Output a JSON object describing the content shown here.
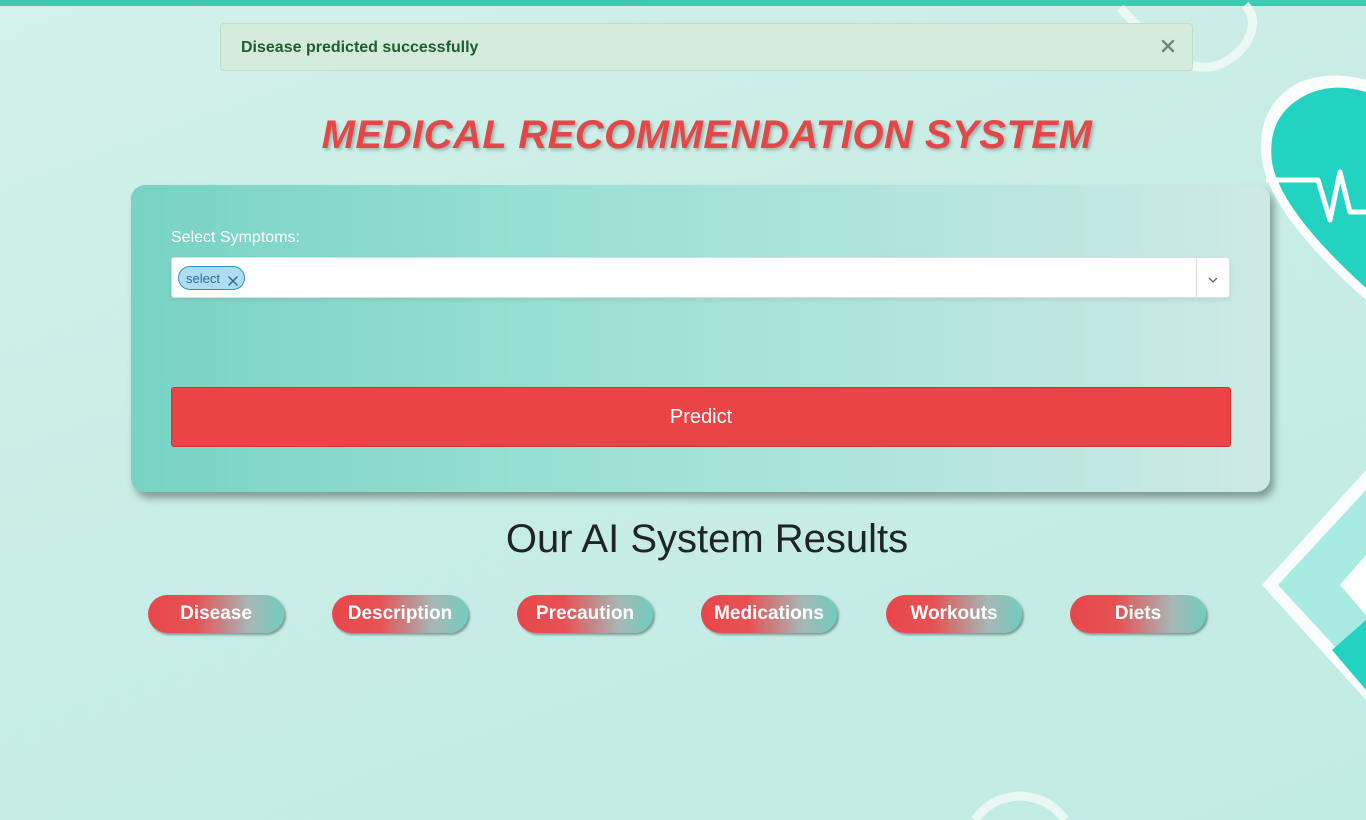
{
  "alert": {
    "message": "Disease predicted successfully",
    "close_icon": "close-icon"
  },
  "header": {
    "title": "MEDICAL RECOMMENDATION SYSTEM"
  },
  "form": {
    "symptoms_label": "Select Symptoms:",
    "selected_symptoms": [
      "select"
    ],
    "chip_remove_icon": "close-icon",
    "dropdown_icon": "chevron-down-icon",
    "predict_label": "Predict"
  },
  "results": {
    "title": "Our AI System Results",
    "buttons": [
      "Disease",
      "Description",
      "Precaution",
      "Medications",
      "Workouts",
      "Diets"
    ]
  },
  "colors": {
    "accent_red": "#ea4446",
    "title_red": "#e34848",
    "teal": "#3fc9b3",
    "alert_bg": "#d5ecdc",
    "alert_text": "#1f5e31",
    "chip_bg": "#aeddf3"
  }
}
